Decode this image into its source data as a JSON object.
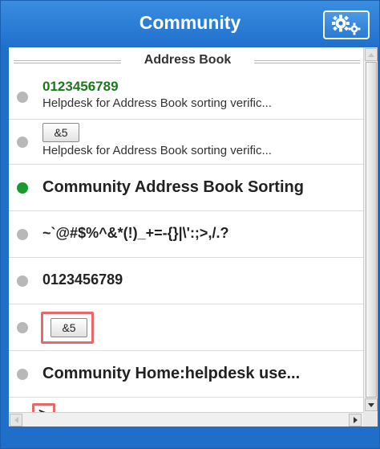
{
  "window": {
    "title": "Community",
    "gear_icon": "settings-gears-icon",
    "accent_color": "#1f6fc9"
  },
  "section": {
    "title": "Address Book"
  },
  "rows": [
    {
      "status": "offline",
      "name": "0123456789",
      "description": "Helpdesk for Address Book sorting verific..."
    },
    {
      "status": "offline",
      "button_label": "&5",
      "description": "Helpdesk for Address Book sorting verific..."
    },
    {
      "status": "online",
      "name": "Community Address Book Sorting"
    },
    {
      "status": "offline",
      "name": "~`@#$%^&*(!)_+=-{}|\\':;>,/.?"
    },
    {
      "status": "offline",
      "name": "0123456789"
    },
    {
      "status": "offline",
      "button_label": "&5"
    },
    {
      "status": "offline",
      "name": "Community Home:helpdesk use..."
    },
    {
      "status": "offline",
      "glyph": ">"
    }
  ]
}
